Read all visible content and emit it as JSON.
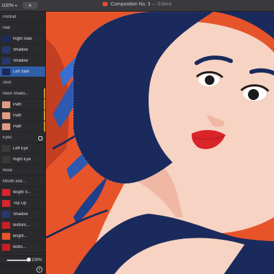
{
  "toolbar": {
    "zoom_value": "100%",
    "add_label": "+",
    "document_title": "Composition No. 3",
    "document_status": "— Edited"
  },
  "layers": [
    {
      "label": "Portrait",
      "kind": "group"
    },
    {
      "label": "Hair",
      "kind": "group"
    },
    {
      "label": "Right Side",
      "kind": "child"
    },
    {
      "label": "Shadow",
      "kind": "child"
    },
    {
      "label": "Shadow",
      "kind": "child"
    },
    {
      "label": "Left Side",
      "kind": "child",
      "selected": true
    },
    {
      "label": "Shirt",
      "kind": "group"
    },
    {
      "label": "Neck Shado...",
      "kind": "group"
    },
    {
      "label": "Path",
      "kind": "child"
    },
    {
      "label": "Path",
      "kind": "child"
    },
    {
      "label": "Path",
      "kind": "child"
    },
    {
      "label": "Eyes",
      "kind": "group"
    },
    {
      "label": "Left Eye",
      "kind": "child"
    },
    {
      "label": "Right Eye",
      "kind": "child"
    },
    {
      "label": "Nose",
      "kind": "group"
    },
    {
      "label": "Mouth and...",
      "kind": "group"
    },
    {
      "label": "Bright S...",
      "kind": "child"
    },
    {
      "label": "Top Lip",
      "kind": "child"
    },
    {
      "label": "Shadow",
      "kind": "child"
    },
    {
      "label": "Bottom...",
      "kind": "child"
    },
    {
      "label": "Bright...",
      "kind": "child"
    },
    {
      "label": "Botto...",
      "kind": "child"
    }
  ],
  "opacity": {
    "value_label": "100%",
    "level": 1.0
  },
  "colors": {
    "background_orange": "#e8542a",
    "hair_navy": "#1b2a5c",
    "skin": "#f6d3c3",
    "lips_red": "#d9242a",
    "selection_blue": "#2f5fa8"
  }
}
